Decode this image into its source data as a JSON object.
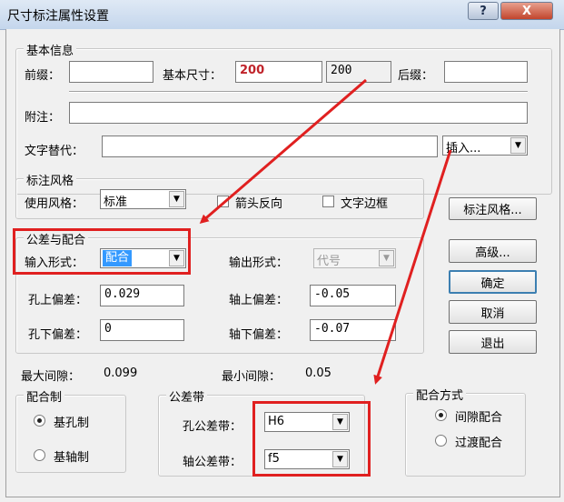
{
  "window": {
    "title": "尺寸标注属性设置",
    "help": "?",
    "close": "X"
  },
  "basic": {
    "legend": "基本信息",
    "prefix_label": "前缀：",
    "prefix_value": "",
    "size_label": "基本尺寸：",
    "size_value": "200",
    "size_value2": "200",
    "suffix_label": "后缀：",
    "suffix_value": "",
    "note_label": "附注：",
    "note_value": "",
    "text_label": "文字替代：",
    "text_value": "",
    "insert_label": "插入..."
  },
  "style": {
    "legend": "标注风格",
    "use_label": "使用风格：",
    "use_value": "标准",
    "arrow_reverse": "箭头反向",
    "text_border": "文字边框",
    "style_button": "标注风格..."
  },
  "tolerance": {
    "legend": "公差与配合",
    "input_label": "输入形式：",
    "input_value": "配合",
    "output_label": "输出形式：",
    "output_value": "代号",
    "hole_upper_label": "孔上偏差：",
    "hole_upper_value": "0.029",
    "shaft_upper_label": "轴上偏差：",
    "shaft_upper_value": "-0.05",
    "hole_lower_label": "孔下偏差：",
    "hole_lower_value": "0",
    "shaft_lower_label": "轴下偏差：",
    "shaft_lower_value": "-0.07"
  },
  "buttons": {
    "advanced": "高级...",
    "ok": "确定",
    "cancel": "取消",
    "exit": "退出"
  },
  "clearance": {
    "max_label": "最大间隙：",
    "max_value": "0.099",
    "min_label": "最小间隙：",
    "min_value": "0.05"
  },
  "fit_system": {
    "legend": "配合制",
    "hole_basis": "基孔制",
    "shaft_basis": "基轴制",
    "selected": "基孔制"
  },
  "tolerance_band": {
    "legend": "公差带",
    "hole_label": "孔公差带：",
    "hole_value": "H6",
    "shaft_label": "轴公差带：",
    "shaft_value": "f5"
  },
  "fit_type": {
    "legend": "配合方式",
    "clearance": "间隙配合",
    "transition": "过渡配合",
    "selected": "间隙配合"
  },
  "colors": {
    "annotation": "#e02020",
    "selection": "#3399ff",
    "size_text": "#c0232a"
  }
}
